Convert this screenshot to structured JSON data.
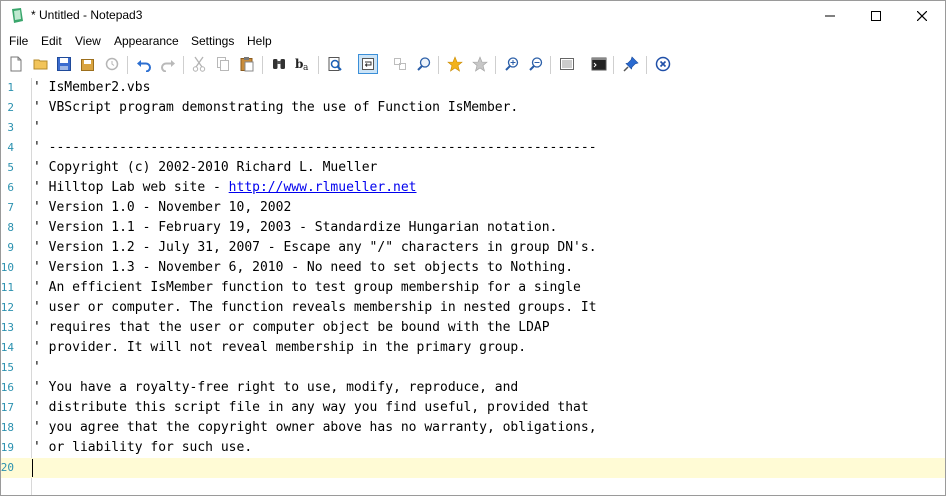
{
  "window": {
    "title": "* Untitled - Notepad3"
  },
  "menu": [
    "File",
    "Edit",
    "View",
    "Appearance",
    "Settings",
    "Help"
  ],
  "toolbar": [
    {
      "name": "new-file-icon"
    },
    {
      "name": "open-file-icon"
    },
    {
      "name": "save-icon"
    },
    {
      "name": "save-as-icon"
    },
    {
      "name": "revert-icon"
    },
    {
      "name": "undo-icon"
    },
    {
      "name": "redo-icon"
    },
    {
      "name": "cut-icon"
    },
    {
      "name": "copy-icon"
    },
    {
      "name": "paste-icon"
    },
    {
      "name": "find-icon"
    },
    {
      "name": "replace-icon"
    },
    {
      "name": "goto-icon"
    },
    {
      "name": "word-wrap-icon"
    },
    {
      "name": "toggle-fold-icon"
    },
    {
      "name": "find-in-files-icon"
    },
    {
      "name": "add-favorite-icon"
    },
    {
      "name": "favorites-icon"
    },
    {
      "name": "zoom-in-icon"
    },
    {
      "name": "zoom-out-icon"
    },
    {
      "name": "scheme-icon"
    },
    {
      "name": "terminal-icon"
    },
    {
      "name": "pin-icon"
    },
    {
      "name": "exit-icon"
    }
  ],
  "editor": {
    "current_line": 20,
    "lines": [
      {
        "n": "1",
        "text": "' IsMember2.vbs"
      },
      {
        "n": "2",
        "text": "' VBScript program demonstrating the use of Function IsMember."
      },
      {
        "n": "3",
        "text": "'"
      },
      {
        "n": "4",
        "text": "' ----------------------------------------------------------------------"
      },
      {
        "n": "5",
        "text": "' Copyright (c) 2002-2010 Richard L. Mueller"
      },
      {
        "n": "6",
        "text": "' Hilltop Lab web site - ",
        "link": "http://www.rlmueller.net"
      },
      {
        "n": "7",
        "text": "' Version 1.0 - November 10, 2002"
      },
      {
        "n": "8",
        "text": "' Version 1.1 - February 19, 2003 - Standardize Hungarian notation."
      },
      {
        "n": "9",
        "text": "' Version 1.2 - July 31, 2007 - Escape any \"/\" characters in group DN's."
      },
      {
        "n": "10",
        "text": "' Version 1.3 - November 6, 2010 - No need to set objects to Nothing."
      },
      {
        "n": "11",
        "text": "' An efficient IsMember function to test group membership for a single"
      },
      {
        "n": "12",
        "text": "' user or computer. The function reveals membership in nested groups. It"
      },
      {
        "n": "13",
        "text": "' requires that the user or computer object be bound with the LDAP"
      },
      {
        "n": "14",
        "text": "' provider. It will not reveal membership in the primary group."
      },
      {
        "n": "15",
        "text": "'"
      },
      {
        "n": "16",
        "text": "' You have a royalty-free right to use, modify, reproduce, and"
      },
      {
        "n": "17",
        "text": "' distribute this script file in any way you find useful, provided that"
      },
      {
        "n": "18",
        "text": "' you agree that the copyright owner above has no warranty, obligations,"
      },
      {
        "n": "19",
        "text": "' or liability for such use."
      },
      {
        "n": "20",
        "text": ""
      }
    ]
  }
}
